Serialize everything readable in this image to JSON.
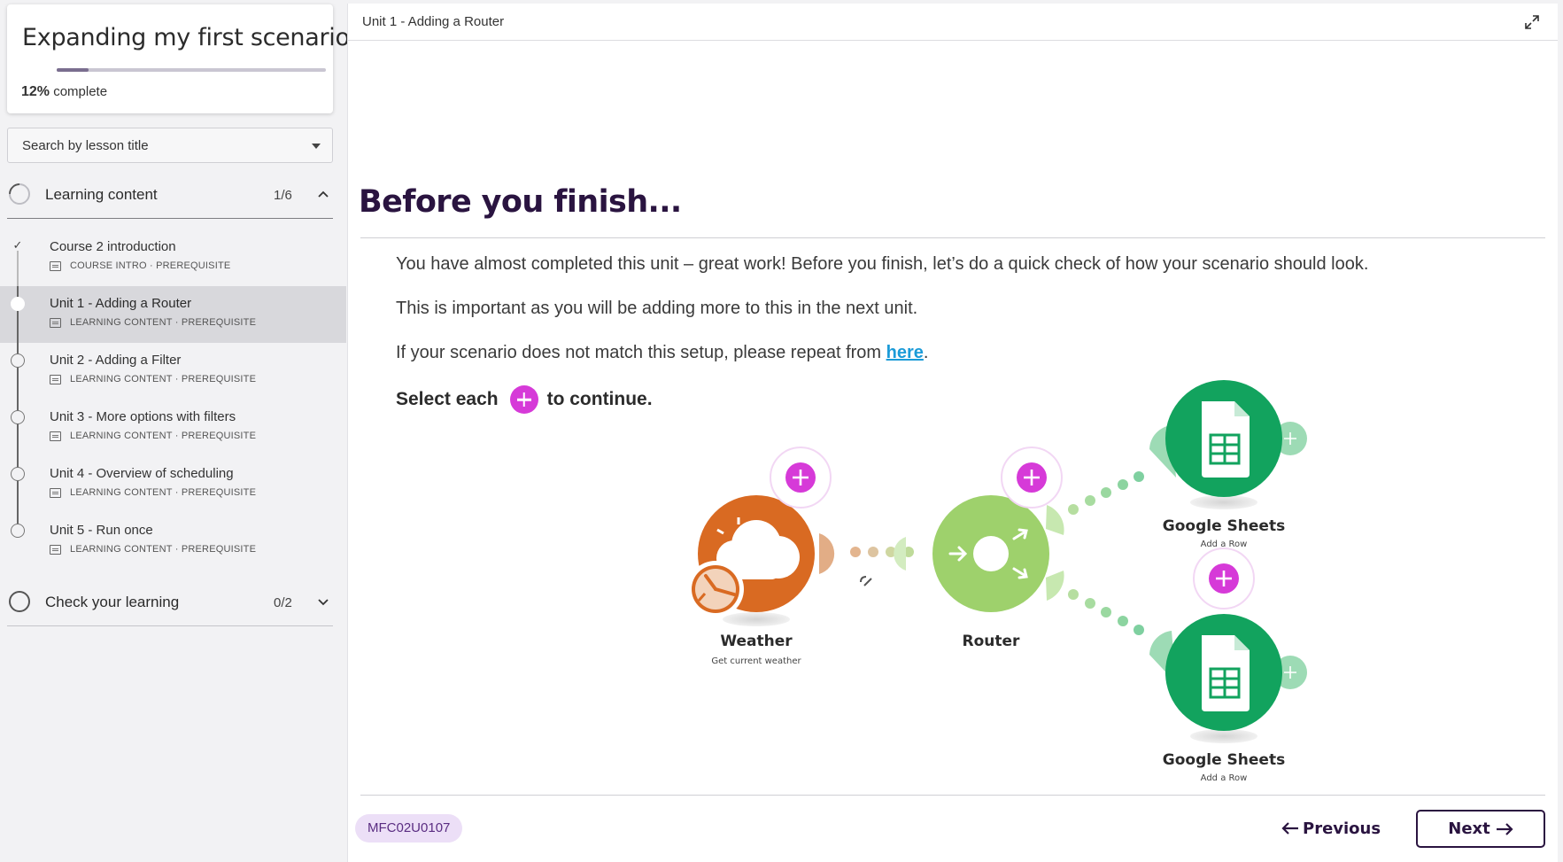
{
  "course": {
    "title": "Expanding my first scenario",
    "progress_percent": 12,
    "progress_value": "12%",
    "progress_suffix": "complete"
  },
  "search": {
    "placeholder": "Search by lesson title"
  },
  "sections": [
    {
      "title": "Learning content",
      "count": "1/6",
      "expanded": true,
      "lessons": [
        {
          "name": "Course 2 introduction",
          "meta": "COURSE INTRO · PREREQUISITE",
          "status": "done"
        },
        {
          "name": "Unit 1 - Adding a Router",
          "meta": "LEARNING CONTENT · PREREQUISITE",
          "status": "current"
        },
        {
          "name": "Unit 2 - Adding a Filter",
          "meta": "LEARNING CONTENT · PREREQUISITE",
          "status": "todo"
        },
        {
          "name": "Unit 3 - More options with filters",
          "meta": "LEARNING CONTENT · PREREQUISITE",
          "status": "todo"
        },
        {
          "name": "Unit 4 - Overview of scheduling",
          "meta": "LEARNING CONTENT · PREREQUISITE",
          "status": "todo"
        },
        {
          "name": "Unit 5 - Run once",
          "meta": "LEARNING CONTENT · PREREQUISITE",
          "status": "todo"
        }
      ]
    },
    {
      "title": "Check your learning",
      "count": "0/2",
      "expanded": false
    }
  ],
  "main": {
    "unit_label": "Unit 1 - Adding a Router",
    "heading": "Before you finish...",
    "para1": "You have almost completed this unit – great work! Before you finish, let’s do a quick check of how your scenario should look.",
    "para2": "This is important as you will be adding more to this in the next unit.",
    "para3_before": "If your scenario does not match this setup, please repeat from ",
    "para3_link": "here",
    "para3_after": ".",
    "select_before": "Select each",
    "select_after": "to continue.",
    "nodes": {
      "weather": {
        "label": "Weather",
        "sub": "Get current weather"
      },
      "router": {
        "label": "Router"
      },
      "sheets1": {
        "label": "Google Sheets",
        "sub": "Add a Row"
      },
      "sheets2": {
        "label": "Google Sheets",
        "sub": "Add a Row"
      }
    },
    "code": "MFC02U0107",
    "prev_label": "Previous",
    "next_label": "Next"
  },
  "colors": {
    "accent_plus": "#d63ad8",
    "weather": "#d96a22",
    "router": "#9ed16c",
    "sheets": "#12a35e",
    "heading": "#2a1440",
    "link": "#1b9bd8"
  }
}
